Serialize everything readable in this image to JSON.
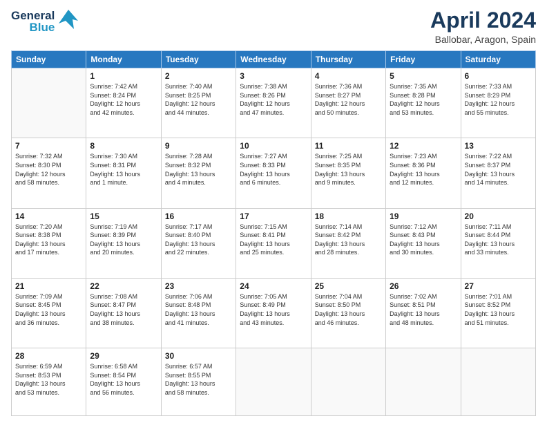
{
  "header": {
    "logo_line1": "General",
    "logo_line2": "Blue",
    "title": "April 2024",
    "subtitle": "Ballobar, Aragon, Spain"
  },
  "calendar": {
    "days_of_week": [
      "Sunday",
      "Monday",
      "Tuesday",
      "Wednesday",
      "Thursday",
      "Friday",
      "Saturday"
    ],
    "weeks": [
      [
        {
          "day": "",
          "info": ""
        },
        {
          "day": "1",
          "info": "Sunrise: 7:42 AM\nSunset: 8:24 PM\nDaylight: 12 hours\nand 42 minutes."
        },
        {
          "day": "2",
          "info": "Sunrise: 7:40 AM\nSunset: 8:25 PM\nDaylight: 12 hours\nand 44 minutes."
        },
        {
          "day": "3",
          "info": "Sunrise: 7:38 AM\nSunset: 8:26 PM\nDaylight: 12 hours\nand 47 minutes."
        },
        {
          "day": "4",
          "info": "Sunrise: 7:36 AM\nSunset: 8:27 PM\nDaylight: 12 hours\nand 50 minutes."
        },
        {
          "day": "5",
          "info": "Sunrise: 7:35 AM\nSunset: 8:28 PM\nDaylight: 12 hours\nand 53 minutes."
        },
        {
          "day": "6",
          "info": "Sunrise: 7:33 AM\nSunset: 8:29 PM\nDaylight: 12 hours\nand 55 minutes."
        }
      ],
      [
        {
          "day": "7",
          "info": "Sunrise: 7:32 AM\nSunset: 8:30 PM\nDaylight: 12 hours\nand 58 minutes."
        },
        {
          "day": "8",
          "info": "Sunrise: 7:30 AM\nSunset: 8:31 PM\nDaylight: 13 hours\nand 1 minute."
        },
        {
          "day": "9",
          "info": "Sunrise: 7:28 AM\nSunset: 8:32 PM\nDaylight: 13 hours\nand 4 minutes."
        },
        {
          "day": "10",
          "info": "Sunrise: 7:27 AM\nSunset: 8:33 PM\nDaylight: 13 hours\nand 6 minutes."
        },
        {
          "day": "11",
          "info": "Sunrise: 7:25 AM\nSunset: 8:35 PM\nDaylight: 13 hours\nand 9 minutes."
        },
        {
          "day": "12",
          "info": "Sunrise: 7:23 AM\nSunset: 8:36 PM\nDaylight: 13 hours\nand 12 minutes."
        },
        {
          "day": "13",
          "info": "Sunrise: 7:22 AM\nSunset: 8:37 PM\nDaylight: 13 hours\nand 14 minutes."
        }
      ],
      [
        {
          "day": "14",
          "info": "Sunrise: 7:20 AM\nSunset: 8:38 PM\nDaylight: 13 hours\nand 17 minutes."
        },
        {
          "day": "15",
          "info": "Sunrise: 7:19 AM\nSunset: 8:39 PM\nDaylight: 13 hours\nand 20 minutes."
        },
        {
          "day": "16",
          "info": "Sunrise: 7:17 AM\nSunset: 8:40 PM\nDaylight: 13 hours\nand 22 minutes."
        },
        {
          "day": "17",
          "info": "Sunrise: 7:15 AM\nSunset: 8:41 PM\nDaylight: 13 hours\nand 25 minutes."
        },
        {
          "day": "18",
          "info": "Sunrise: 7:14 AM\nSunset: 8:42 PM\nDaylight: 13 hours\nand 28 minutes."
        },
        {
          "day": "19",
          "info": "Sunrise: 7:12 AM\nSunset: 8:43 PM\nDaylight: 13 hours\nand 30 minutes."
        },
        {
          "day": "20",
          "info": "Sunrise: 7:11 AM\nSunset: 8:44 PM\nDaylight: 13 hours\nand 33 minutes."
        }
      ],
      [
        {
          "day": "21",
          "info": "Sunrise: 7:09 AM\nSunset: 8:45 PM\nDaylight: 13 hours\nand 36 minutes."
        },
        {
          "day": "22",
          "info": "Sunrise: 7:08 AM\nSunset: 8:47 PM\nDaylight: 13 hours\nand 38 minutes."
        },
        {
          "day": "23",
          "info": "Sunrise: 7:06 AM\nSunset: 8:48 PM\nDaylight: 13 hours\nand 41 minutes."
        },
        {
          "day": "24",
          "info": "Sunrise: 7:05 AM\nSunset: 8:49 PM\nDaylight: 13 hours\nand 43 minutes."
        },
        {
          "day": "25",
          "info": "Sunrise: 7:04 AM\nSunset: 8:50 PM\nDaylight: 13 hours\nand 46 minutes."
        },
        {
          "day": "26",
          "info": "Sunrise: 7:02 AM\nSunset: 8:51 PM\nDaylight: 13 hours\nand 48 minutes."
        },
        {
          "day": "27",
          "info": "Sunrise: 7:01 AM\nSunset: 8:52 PM\nDaylight: 13 hours\nand 51 minutes."
        }
      ],
      [
        {
          "day": "28",
          "info": "Sunrise: 6:59 AM\nSunset: 8:53 PM\nDaylight: 13 hours\nand 53 minutes."
        },
        {
          "day": "29",
          "info": "Sunrise: 6:58 AM\nSunset: 8:54 PM\nDaylight: 13 hours\nand 56 minutes."
        },
        {
          "day": "30",
          "info": "Sunrise: 6:57 AM\nSunset: 8:55 PM\nDaylight: 13 hours\nand 58 minutes."
        },
        {
          "day": "",
          "info": ""
        },
        {
          "day": "",
          "info": ""
        },
        {
          "day": "",
          "info": ""
        },
        {
          "day": "",
          "info": ""
        }
      ]
    ]
  }
}
